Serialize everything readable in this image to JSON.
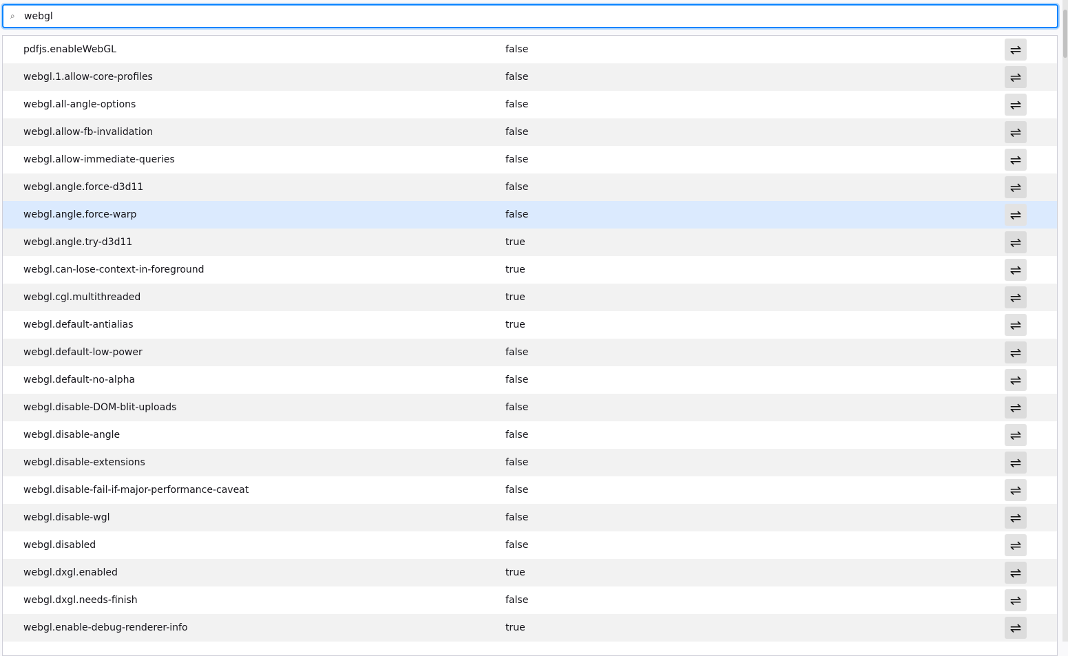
{
  "search": {
    "value": "webgl",
    "icon": "search-icon"
  },
  "toggle_icon": "⇌",
  "prefs": [
    {
      "name": "pdfjs.enableWebGL",
      "value": "false"
    },
    {
      "name": "webgl.1.allow-core-profiles",
      "value": "false"
    },
    {
      "name": "webgl.all-angle-options",
      "value": "false"
    },
    {
      "name": "webgl.allow-fb-invalidation",
      "value": "false"
    },
    {
      "name": "webgl.allow-immediate-queries",
      "value": "false"
    },
    {
      "name": "webgl.angle.force-d3d11",
      "value": "false"
    },
    {
      "name": "webgl.angle.force-warp",
      "value": "false"
    },
    {
      "name": "webgl.angle.try-d3d11",
      "value": "true"
    },
    {
      "name": "webgl.can-lose-context-in-foreground",
      "value": "true"
    },
    {
      "name": "webgl.cgl.multithreaded",
      "value": "true"
    },
    {
      "name": "webgl.default-antialias",
      "value": "true"
    },
    {
      "name": "webgl.default-low-power",
      "value": "false"
    },
    {
      "name": "webgl.default-no-alpha",
      "value": "false"
    },
    {
      "name": "webgl.disable-DOM-blit-uploads",
      "value": "false"
    },
    {
      "name": "webgl.disable-angle",
      "value": "false"
    },
    {
      "name": "webgl.disable-extensions",
      "value": "false"
    },
    {
      "name": "webgl.disable-fail-if-major-performance-caveat",
      "value": "false"
    },
    {
      "name": "webgl.disable-wgl",
      "value": "false"
    },
    {
      "name": "webgl.disabled",
      "value": "false"
    },
    {
      "name": "webgl.dxgl.enabled",
      "value": "true"
    },
    {
      "name": "webgl.dxgl.needs-finish",
      "value": "false"
    },
    {
      "name": "webgl.enable-debug-renderer-info",
      "value": "true"
    }
  ],
  "highlighted_index": 6
}
